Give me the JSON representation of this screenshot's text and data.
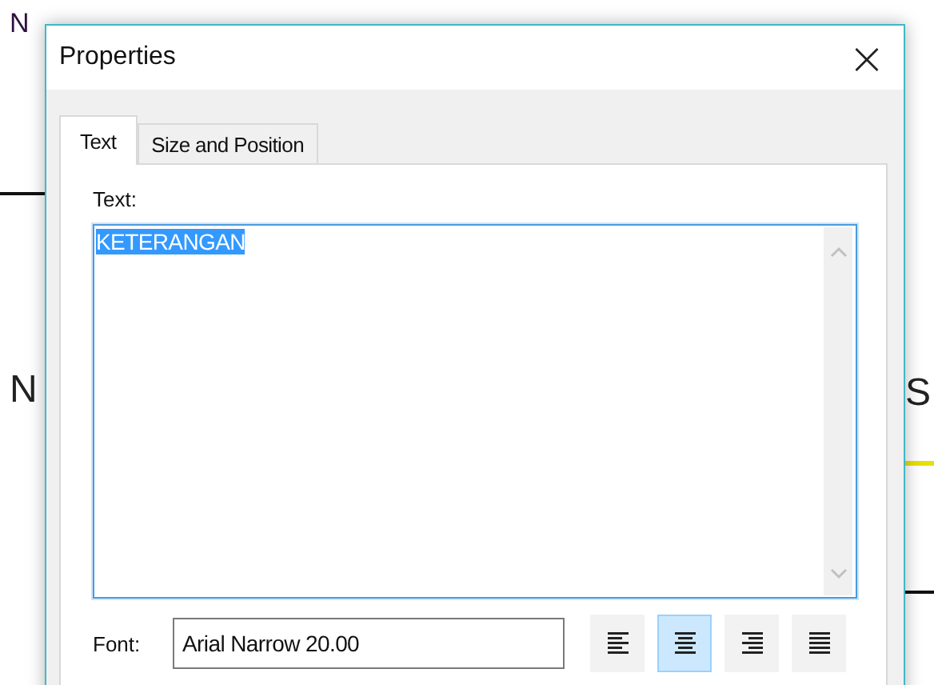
{
  "background_document": {
    "fragments": [
      {
        "kind": "top",
        "text": "N"
      },
      {
        "kind": "left",
        "text": "N"
      },
      {
        "kind": "right",
        "text": "S"
      }
    ]
  },
  "window": {
    "title": "Properties",
    "close": "×"
  },
  "tabs": [
    {
      "label": "Text",
      "selected": true
    },
    {
      "label": "Size and Position",
      "selected": false
    }
  ],
  "text_field": {
    "label": "Text:",
    "value": "KETERANGAN",
    "selected": true
  },
  "font": {
    "label": "Font:",
    "value": "Arial Narrow 20.00"
  },
  "alignment": [
    {
      "kind": "left",
      "selected": false
    },
    {
      "kind": "center",
      "selected": true
    },
    {
      "kind": "right",
      "selected": false
    },
    {
      "kind": "justify",
      "selected": false
    }
  ]
}
